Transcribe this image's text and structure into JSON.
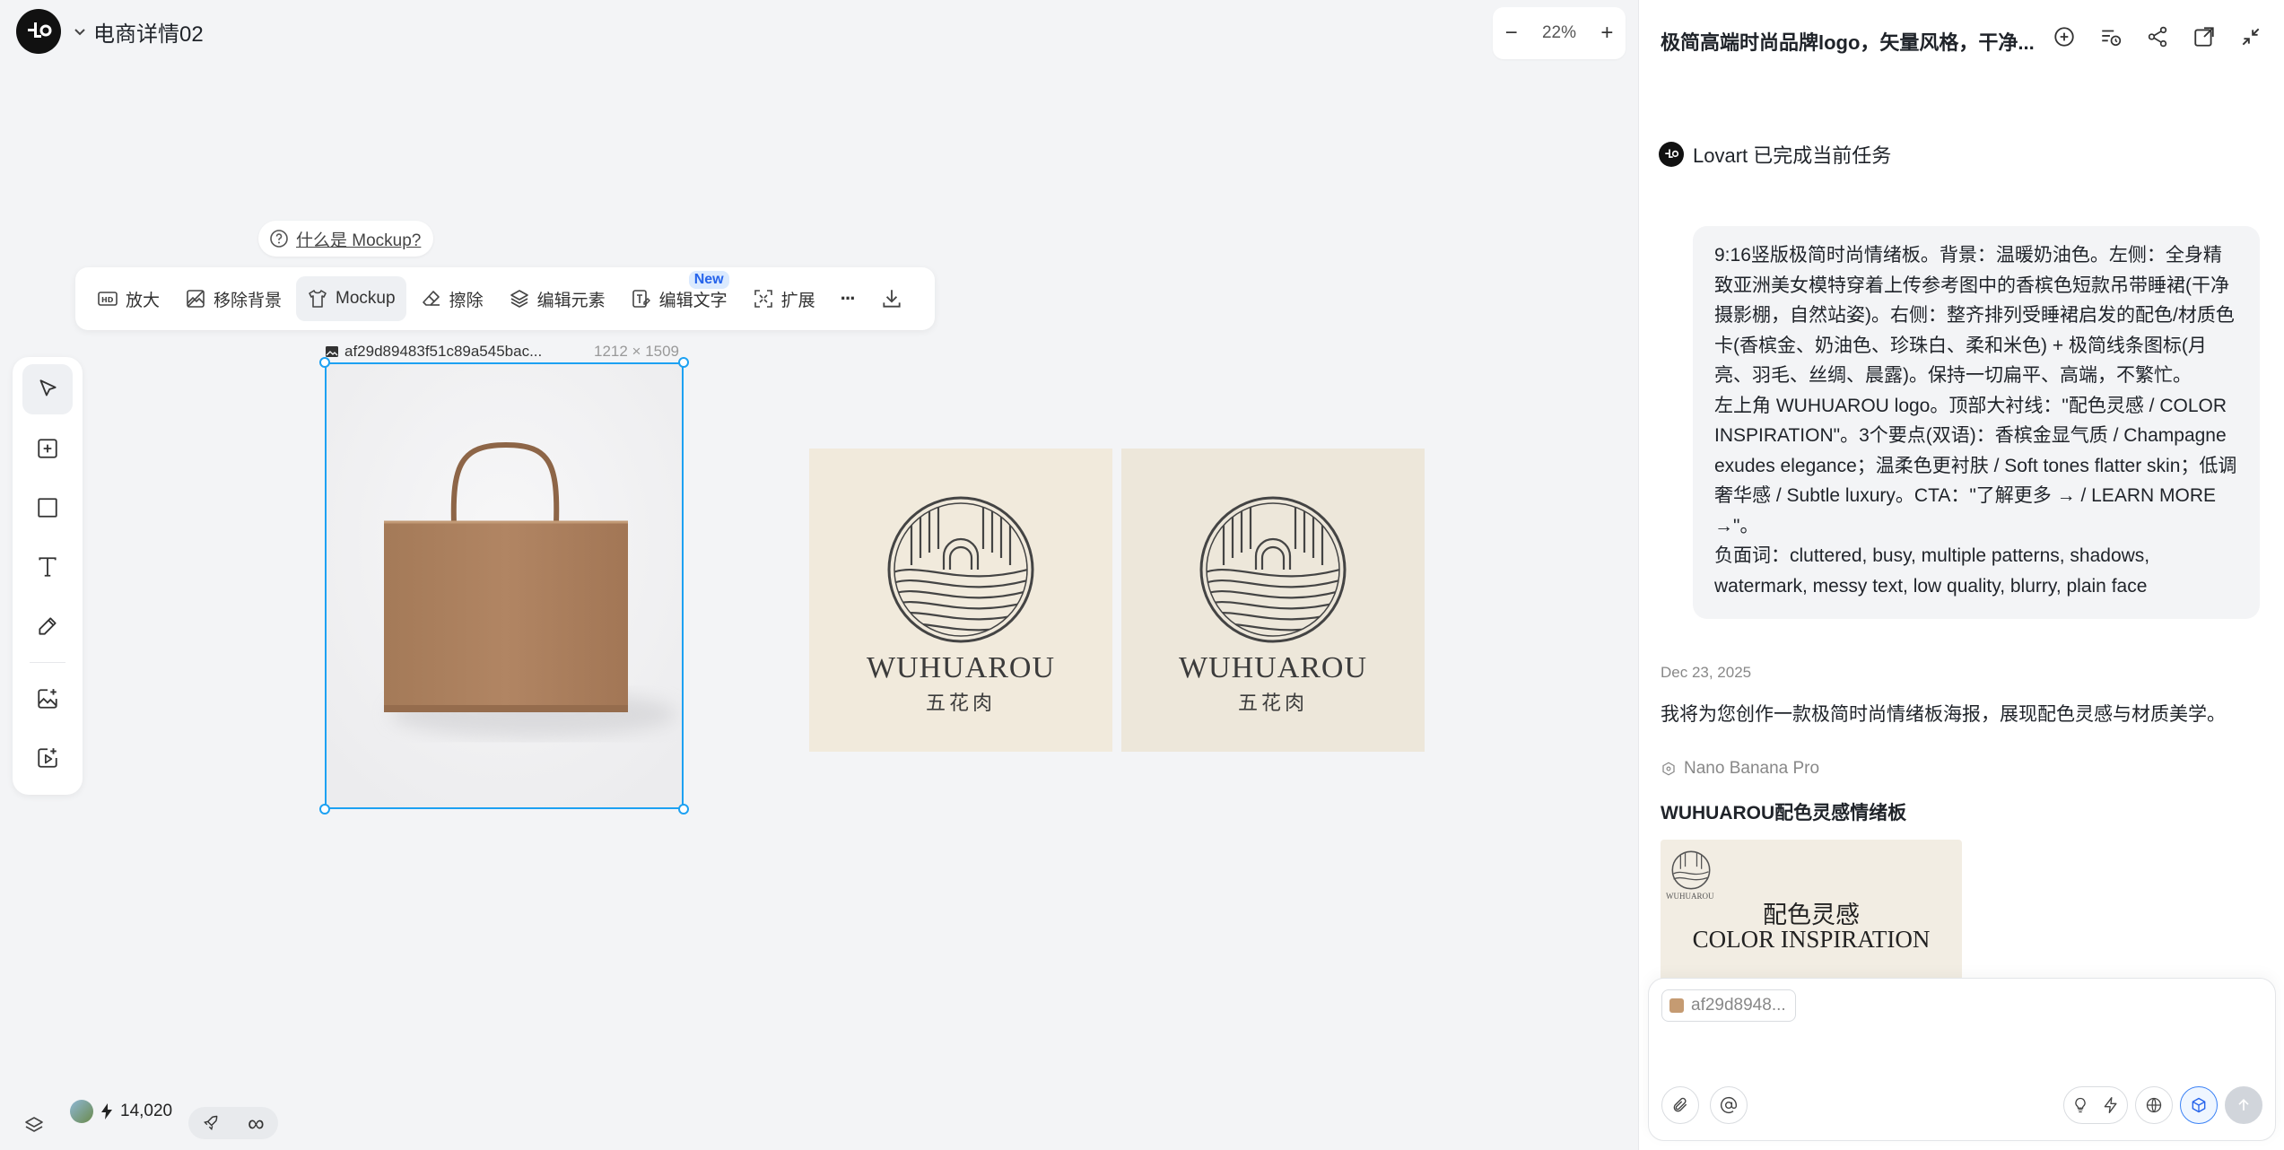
{
  "header": {
    "project_title": "电商详情02"
  },
  "zoom": {
    "minus": "−",
    "level": "22%",
    "plus": "+"
  },
  "hint": {
    "text": "什么是 Mockup?"
  },
  "toolbar": {
    "items": [
      {
        "label": "放大",
        "icon": "hd-icon"
      },
      {
        "label": "移除背景",
        "icon": "remove-bg-icon"
      },
      {
        "label": "Mockup",
        "icon": "tshirt-icon"
      },
      {
        "label": "擦除",
        "icon": "eraser-icon"
      },
      {
        "label": "编辑元素",
        "icon": "layers-edit-icon"
      },
      {
        "label": "编辑文字",
        "icon": "text-edit-icon"
      },
      {
        "label": "扩展",
        "icon": "expand-icon"
      }
    ],
    "new_badge": "New",
    "more": "···"
  },
  "canvas": {
    "selected_image_name": "af29d89483f51c89a545bac...",
    "selected_image_dims": "1212 × 1509",
    "logo_brand": "WUHUAROU",
    "logo_brand_cn": "五花肉"
  },
  "bottom": {
    "credits": "14,020",
    "infinity": "∞"
  },
  "panel": {
    "title": "极简高端时尚品牌logo，矢量风格，干净...",
    "status": "Lovart 已完成当前任务",
    "prompt_lines": [
      " 9:16竖版极简时尚情绪板。背景：温暖奶油色。左侧：全身精致亚洲美女模特穿着上传参考图中的香槟色短款吊带睡裙(干净摄影棚，自然站姿)。右侧：整齐排列受睡裙启发的配色/材质色卡(香槟金、奶油色、珍珠白、柔和米色) + 极简线条图标(月亮、羽毛、丝绸、晨露)。保持一切扁平、高端，不繁忙。",
      "左上角 WUHUAROU logo。顶部大衬线：\"配色灵感 / COLOR INSPIRATION\"。3个要点(双语)：香槟金显气质 / Champagne exudes elegance；温柔色更衬肤 / Soft tones flatter skin；低调奢华感 / Subtle luxury。CTA：\"了解更多 → / LEARN MORE →\"。",
      "负面词：cluttered, busy, multiple patterns, shadows, watermark, messy text, low quality, blurry, plain face"
    ],
    "date": "Dec 23, 2025",
    "reply": "我将为您创作一款极简时尚情绪板海报，展现配色灵感与材质美学。",
    "model": "Nano Banana Pro",
    "result_title": "WUHUAROU配色灵感情绪板",
    "thumb_title_cn": "配色灵感",
    "thumb_title_en": "COLOR INSPIRATION",
    "thumb_logo_text": "WUHUAROU",
    "input_chip": "af29d8948..."
  }
}
